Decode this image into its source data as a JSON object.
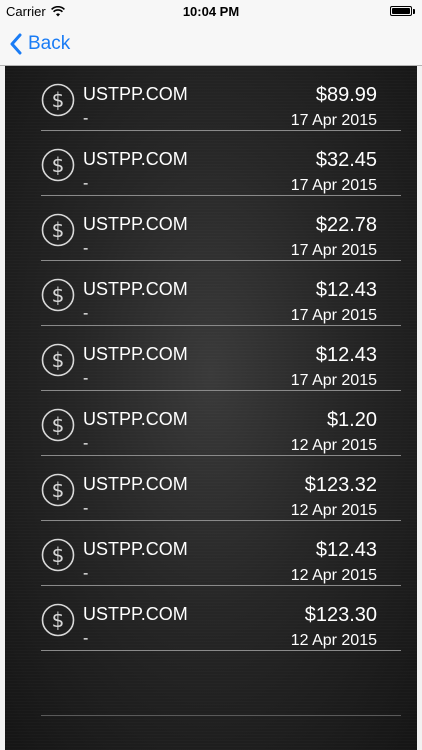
{
  "status_bar": {
    "carrier": "Carrier",
    "time": "10:04 PM"
  },
  "nav": {
    "back_label": "Back"
  },
  "transactions": [
    {
      "merchant": "USTPP.COM",
      "subtitle": "-",
      "amount": "$89.99",
      "date": "17 Apr 2015"
    },
    {
      "merchant": "USTPP.COM",
      "subtitle": "-",
      "amount": "$32.45",
      "date": "17 Apr 2015"
    },
    {
      "merchant": "USTPP.COM",
      "subtitle": "-",
      "amount": "$22.78",
      "date": "17 Apr 2015"
    },
    {
      "merchant": "USTPP.COM",
      "subtitle": "-",
      "amount": "$12.43",
      "date": "17 Apr 2015"
    },
    {
      "merchant": "USTPP.COM",
      "subtitle": "-",
      "amount": "$12.43",
      "date": "17 Apr 2015"
    },
    {
      "merchant": "USTPP.COM",
      "subtitle": "-",
      "amount": "$1.20",
      "date": "12 Apr 2015"
    },
    {
      "merchant": "USTPP.COM",
      "subtitle": "-",
      "amount": "$123.32",
      "date": "12 Apr 2015"
    },
    {
      "merchant": "USTPP.COM",
      "subtitle": "-",
      "amount": "$12.43",
      "date": "12 Apr 2015"
    },
    {
      "merchant": "USTPP.COM",
      "subtitle": "-",
      "amount": "$123.30",
      "date": "12 Apr 2015"
    }
  ],
  "icons": {
    "row_icon": "dollar-circle-icon",
    "back_icon": "chevron-left-icon"
  },
  "colors": {
    "accent": "#1a7cf5",
    "text": "#ffffff",
    "divider": "#8a8a8a"
  }
}
